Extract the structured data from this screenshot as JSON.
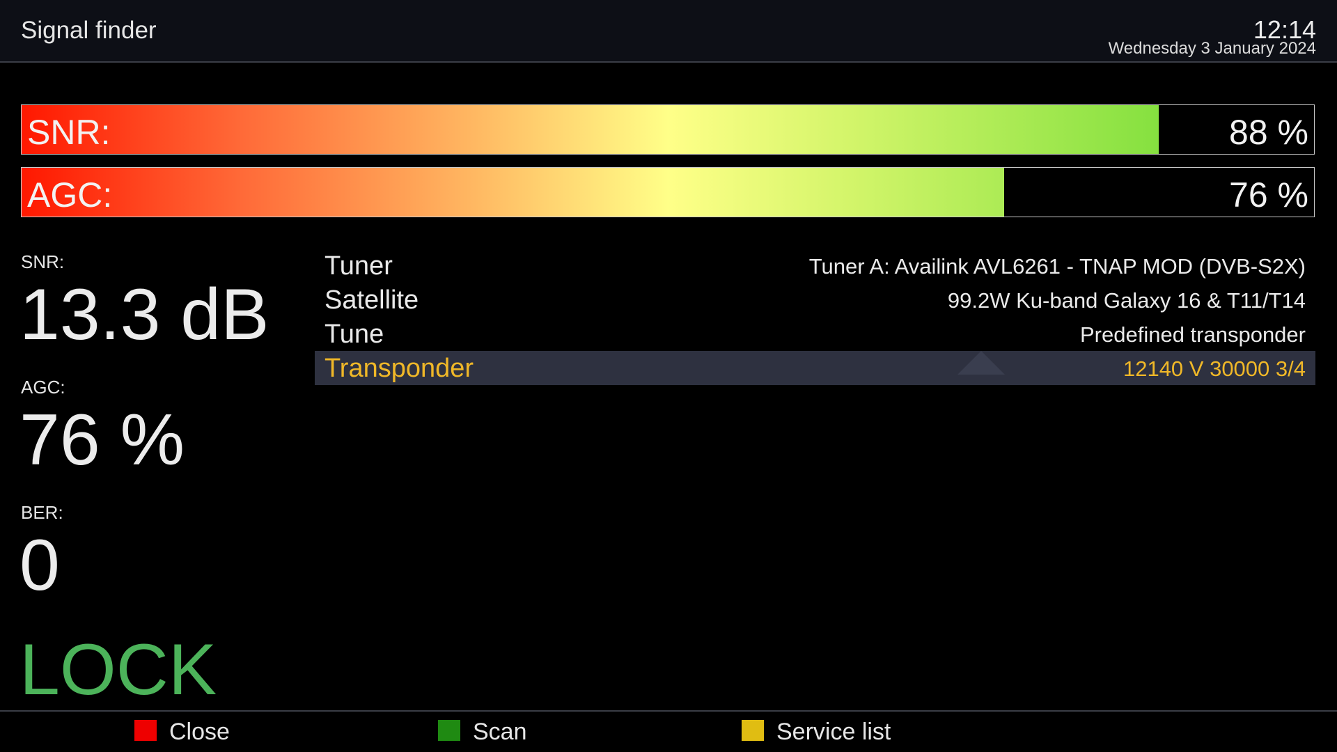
{
  "header": {
    "title": "Signal finder",
    "time": "12:14",
    "date": "Wednesday  3 January 2024"
  },
  "bars": {
    "snr": {
      "label": "SNR:",
      "value_text": "88 %",
      "percent": 88
    },
    "agc": {
      "label": "AGC:",
      "value_text": "76 %",
      "percent": 76
    }
  },
  "stats": {
    "snr": {
      "label": "SNR:",
      "value": "13.3 dB"
    },
    "agc": {
      "label": "AGC:",
      "value": "76 %"
    },
    "ber": {
      "label": "BER:",
      "value": "0"
    },
    "status": "LOCK"
  },
  "info": [
    {
      "label": "Tuner",
      "value": "Tuner A: Availink AVL6261 - TNAP MOD (DVB-S2X)"
    },
    {
      "label": "Satellite",
      "value": "99.2W Ku-band Galaxy 16 & T11/T14"
    },
    {
      "label": "Tune",
      "value": "Predefined transponder"
    },
    {
      "label": "Transponder",
      "value": "12140 V 30000 3/4",
      "selected": true
    }
  ],
  "footer": {
    "keys": [
      {
        "label": "Close",
        "color": "#ee0000"
      },
      {
        "label": "Scan",
        "color": "#1f8a12"
      },
      {
        "label": "Service list",
        "color": "#e0bd12"
      }
    ]
  },
  "colors": {
    "accent_selected": "#f0b828",
    "lock": "#4cb35a"
  }
}
